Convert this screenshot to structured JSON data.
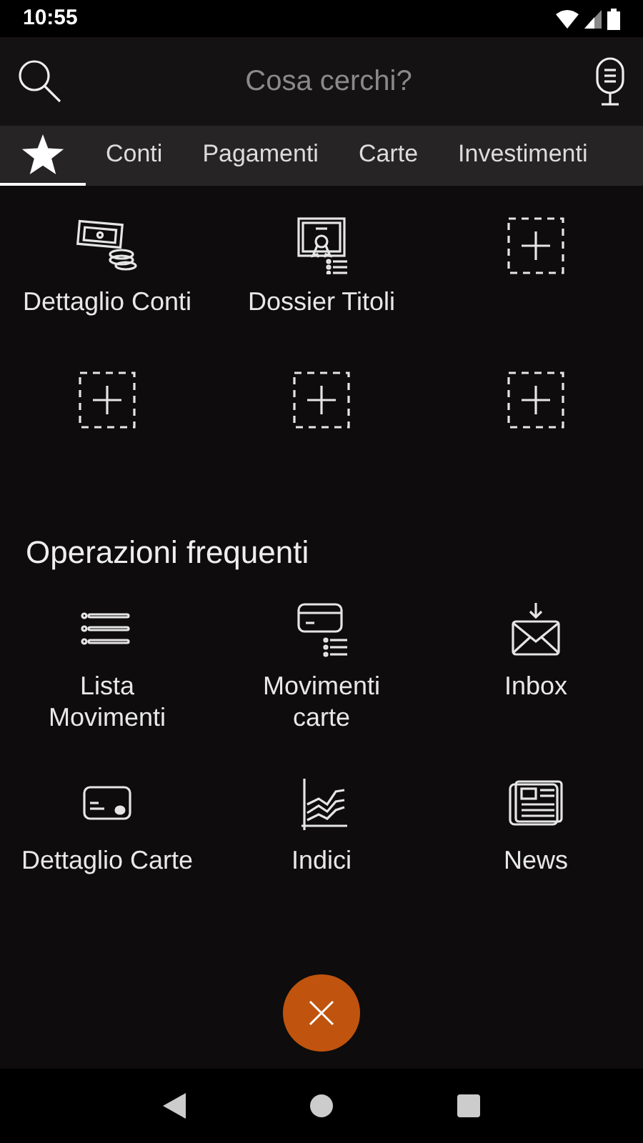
{
  "status_bar": {
    "time": "10:55"
  },
  "search": {
    "placeholder": "Cosa cerchi?"
  },
  "tabs": [
    {
      "kind": "star",
      "selected": true
    },
    {
      "kind": "text",
      "label": "Conti",
      "selected": false
    },
    {
      "kind": "text",
      "label": "Pagamenti",
      "selected": false
    },
    {
      "kind": "text",
      "label": "Carte",
      "selected": false
    },
    {
      "kind": "text",
      "label": "Investimenti",
      "selected": false
    }
  ],
  "favorites": [
    {
      "kind": "money",
      "label": "Dettaglio Conti"
    },
    {
      "kind": "certificate",
      "label": "Dossier Titoli"
    },
    {
      "kind": "add"
    },
    {
      "kind": "add"
    },
    {
      "kind": "add"
    },
    {
      "kind": "add"
    }
  ],
  "frequent": {
    "title": "Operazioni frequenti",
    "items": [
      {
        "kind": "list",
        "label": "Lista Movimenti"
      },
      {
        "kind": "card-list",
        "label": "Movimenti carte"
      },
      {
        "kind": "inbox",
        "label": "Inbox"
      },
      {
        "kind": "card",
        "label": "Dettaglio Carte"
      },
      {
        "kind": "chart",
        "label": "Indici"
      },
      {
        "kind": "news",
        "label": "News"
      }
    ]
  }
}
